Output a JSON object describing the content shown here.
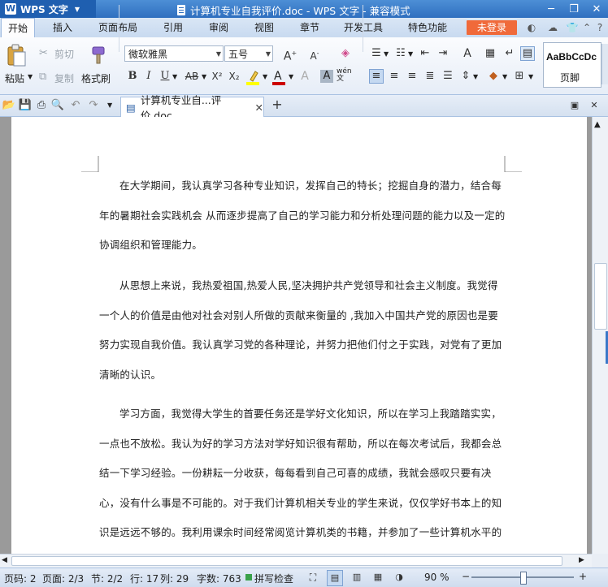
{
  "app": {
    "name": "WPS 文字",
    "logo_letter": "W",
    "window_title": "计算机专业自我评价.doc - WPS 文字 - 兼容模式"
  },
  "tabs": [
    "开始",
    "插入",
    "页面布局",
    "引用",
    "审阅",
    "视图",
    "章节",
    "开发工具",
    "特色功能"
  ],
  "active_tab": "开始",
  "login_label": "未登录",
  "ribbon": {
    "paste": "粘贴",
    "cut": "剪切",
    "copy": "复制",
    "format_painter": "格式刷",
    "font_name": "微软雅黑",
    "font_size": "五号",
    "style_preview": "AaBbCcDc",
    "style_name": "页脚",
    "font_color": "#cc0000",
    "highlight_color": "#ffff00"
  },
  "document_tab": {
    "name": "计算机专业自...评价.doc"
  },
  "document": {
    "paragraphs": [
      "在大学期间，我认真学习各种专业知识，发挥自己的特长；挖掘自身的潜力，结合每年的暑期社会实践机会 从而逐步提高了自己的学习能力和分析处理问题的能力以及一定的协调组织和管理能力。",
      "从思想上来说，我热爱祖国,热爱人民,坚决拥护共产党领导和社会主义制度。我觉得一个人的价值是由他对社会对别人所做的贡献来衡量的 ,我加入中国共产党的原因也是要努力实现自我价值。我认真学习党的各种理论，并努力把他们付之于实践，对党有了更加清晰的认识。",
      "学习方面，我觉得大学生的首要任务还是学好文化知识，所以在学习上我踏踏实实，一点也不放松。我认为好的学习方法对学好知识很有帮助，所以在每次考试后，我都会总结一下学习经验。一份耕耘一分收获，每每看到自己可喜的成绩，我就会感叹只要有决心，没有什么事是不可能的。对于我们计算机相关专业的学生来说，仅仅学好书本上的知识是远远不够的。我利用课余时间经常阅览计算机类的书籍，并参加了一些计算机水平的资格考试，"
    ]
  },
  "status": {
    "page_code": "页码: 2",
    "page": "页面: 2/3",
    "section": "节: 2/2",
    "row": "行: 17",
    "column": "列: 29",
    "word_count": "字数: 763",
    "spell_check": "拼写检查",
    "zoom": "90 %",
    "zoom_level_fraction": 0.5
  }
}
